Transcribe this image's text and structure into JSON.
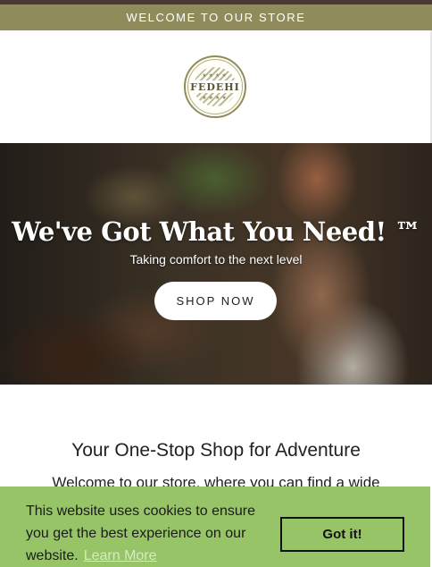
{
  "announcement": {
    "text": "WELCOME TO OUR STORE"
  },
  "logo": {
    "text": "FEDEHI"
  },
  "hero": {
    "title": "We've Got What You Need! ™",
    "subtitle": "Taking comfort to the next level",
    "button_label": "SHOP NOW"
  },
  "main": {
    "title": "Your One-Stop Shop for Adventure",
    "text": "Welcome to our store, where you can find a wide"
  },
  "cookie_banner": {
    "message": "This website uses cookies to ensure you get the best experience on our website.",
    "link_label": "Learn More",
    "button_label": "Got it!"
  },
  "colors": {
    "announcement_bg": "#8f8b5b",
    "cookie_bg": "#97c467",
    "top_line": "#4a3a33"
  }
}
